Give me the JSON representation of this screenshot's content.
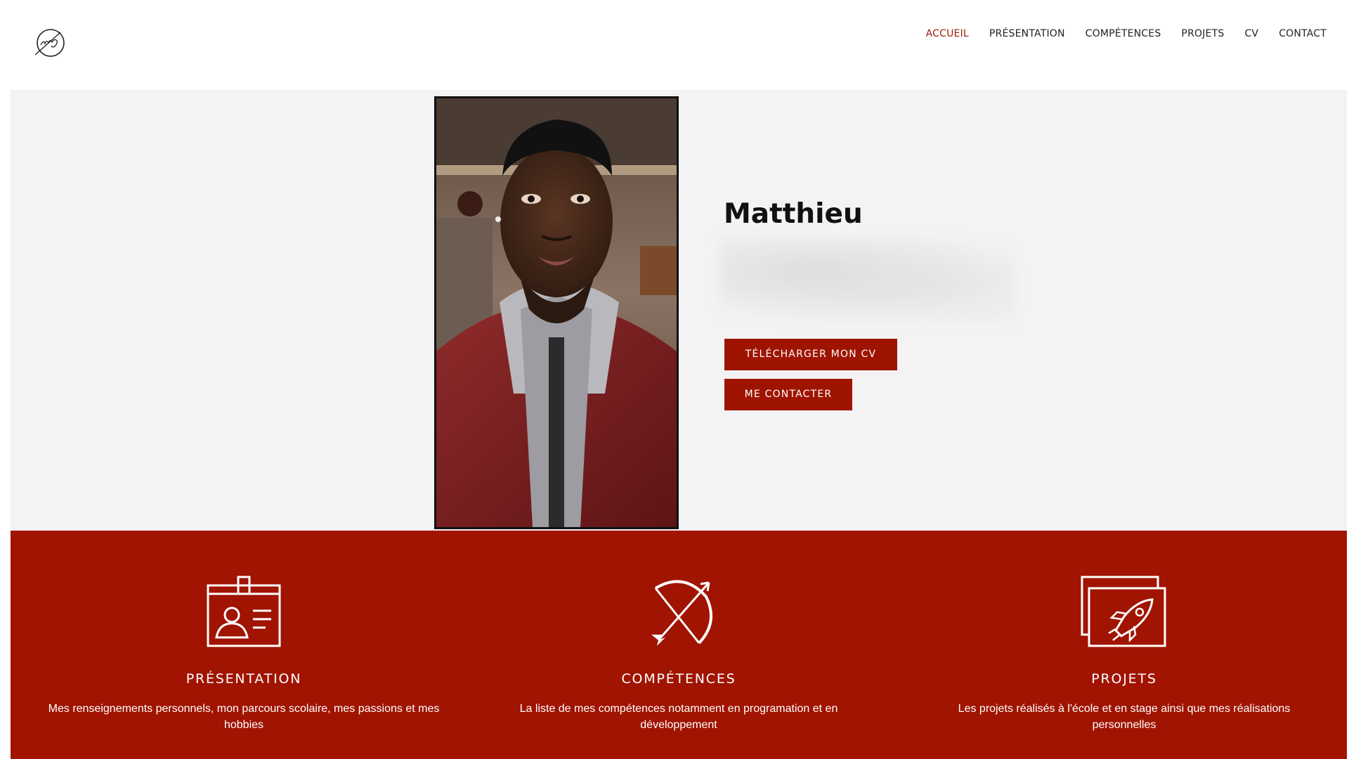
{
  "nav": {
    "items": [
      {
        "label": "ACCUEIL",
        "active": true
      },
      {
        "label": "PRÉSENTATION",
        "active": false
      },
      {
        "label": "COMPÉTENCES",
        "active": false
      },
      {
        "label": "PROJETS",
        "active": false
      },
      {
        "label": "CV",
        "active": false
      },
      {
        "label": "CONTACT",
        "active": false
      }
    ]
  },
  "logo": {
    "icon": "signature-logo-icon"
  },
  "hero": {
    "name": "Matthieu",
    "buttons": {
      "download_cv": "TÉLÉCHARGER MON CV",
      "contact": "ME CONTACTER"
    }
  },
  "features": [
    {
      "icon": "id-card-icon",
      "title": "PRÉSENTATION",
      "description": "Mes renseignements personnels, mon parcours scolaire, mes passions et mes hobbies"
    },
    {
      "icon": "bow-arrow-icon",
      "title": "COMPÉTENCES",
      "description": "La liste de mes compétences notamment en programation et en développement"
    },
    {
      "icon": "rocket-icon",
      "title": "PROJETS",
      "description": "Les projets réalisés à l'école et en stage ainsi que mes réalisations personnelles"
    }
  ],
  "colors": {
    "accent": "#a01401",
    "nav_active": "#9f1b0a",
    "hero_bg": "#f3f3f3"
  }
}
